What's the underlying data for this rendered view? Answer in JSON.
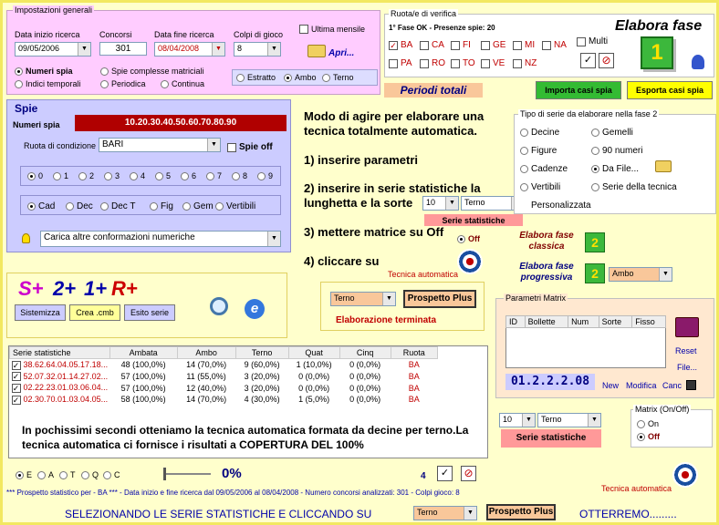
{
  "impostazioni": {
    "legend": "Impostazioni generali",
    "data_inizio_label": "Data inizio ricerca",
    "data_inizio": "09/05/2006",
    "concorsi_label": "Concorsi",
    "concorsi": "301",
    "data_fine_label": "Data fine ricerca",
    "data_fine": "08/04/2008",
    "colpi_label": "Colpi di gioco",
    "colpi": "8",
    "ultima_mensile": "Ultima mensile",
    "apri": "Apri...",
    "modes": [
      "Numeri spia",
      "Spie complesse matriciali",
      "Indici temporali",
      "Periodica",
      "Continua"
    ],
    "sorte": [
      "Estratto",
      "Ambo",
      "Terno"
    ]
  },
  "ruote": {
    "legend": "Ruota/e di verifica",
    "status": "1° Fase OK - Presenze spie: 20",
    "row1": [
      "BA",
      "CA",
      "FI",
      "GE",
      "MI",
      "NA"
    ],
    "row2": [
      "PA",
      "RO",
      "TO",
      "VE",
      "NZ"
    ],
    "multi": "Multi"
  },
  "elabora_fase": "Elabora fase",
  "fase_num": "1",
  "periodi_totali": "Periodi totali",
  "importa": "Importa casi spia",
  "esporta": "Esporta casi spia",
  "spie": {
    "title": "Spie",
    "numeri_spia_label": "Numeri spia",
    "numeri_spia": "10.20.30.40.50.60.70.80.90",
    "ruota_label": "Ruota di condizione",
    "ruota": "BARI",
    "spie_off": "Spie off",
    "digits": [
      "0",
      "1",
      "2",
      "3",
      "4",
      "5",
      "6",
      "7",
      "8",
      "9"
    ],
    "types": [
      "Cad",
      "Dec",
      "Dec T",
      "Fig",
      "Gem",
      "Vertibili"
    ],
    "carica": "Carica altre conformazioni numeriche"
  },
  "istruzioni": {
    "intro": "Modo di agire per elaborare una tecnica totalmente automatica.",
    "step1": "1) inserire parametri",
    "step2": "2) inserire in serie statistiche la lunghetta e la sorte",
    "step3": "3) mettere matrice su Off",
    "step4": "4) cliccare su",
    "lunghetta": "10",
    "sorte": "Terno",
    "serie_btn": "Serie statistiche",
    "off": "Off",
    "tecnica_automatica": "Tecnica automatica"
  },
  "tipo_serie": {
    "legend": "Tipo di serie da elaborare nella fase 2",
    "options": [
      "Decine",
      "Gemelli",
      "Figure",
      "90 numeri",
      "Cadenze",
      "Da File...",
      "Vertibili",
      "Serie della tecnica"
    ],
    "personalizzata": "Personalizzata",
    "classica": "Elabora fase classica",
    "progressiva": "Elabora fase progressiva",
    "fase2": "2",
    "ambo": "Ambo"
  },
  "splus": {
    "s": "S+",
    "two": "2+",
    "one": "1+",
    "r": "R+",
    "sistemizza": "Sistemizza",
    "crea": "Crea .cmb",
    "esito": "Esito serie"
  },
  "prospetto": {
    "sorte": "Terno",
    "btn": "Prospetto Plus",
    "status": "Elaborazione terminata"
  },
  "matrix": {
    "legend": "Parametri Matrix",
    "cols": [
      "ID",
      "Bollette",
      "Num",
      "Sorte",
      "Fisso"
    ],
    "reset": "Reset",
    "file": "File...",
    "code": "01.2.2.2.08",
    "new": "New",
    "modifica": "Modifica",
    "canc": "Canc",
    "onoff_legend": "Matrix (On/Off)",
    "on": "On",
    "off": "Off",
    "lunghetta": "10",
    "sorte": "Terno",
    "serie_btn": "Serie statistiche",
    "tecnica_automatica": "Tecnica automatica"
  },
  "table": {
    "headers": [
      "Serie statistiche",
      "Ambata",
      "Ambo",
      "Terno",
      "Quat",
      "Cinq",
      "Ruota"
    ],
    "rows": [
      [
        "38.62.64.04.05.17.18...",
        "48 (100,0%)",
        "14 (70,0%)",
        "9 (60,0%)",
        "1 (10,0%)",
        "0 (0,0%)",
        "BA"
      ],
      [
        "52.07.32.01.14.27.02...",
        "57 (100,0%)",
        "11 (55,0%)",
        "3 (20,0%)",
        "0 (0,0%)",
        "0 (0,0%)",
        "BA"
      ],
      [
        "02.22.23.01.03.06.04...",
        "57 (100,0%)",
        "12 (40,0%)",
        "3 (20,0%)",
        "0 (0,0%)",
        "0 (0,0%)",
        "BA"
      ],
      [
        "02.30.70.01.03.04.05...",
        "58 (100,0%)",
        "14 (70,0%)",
        "4 (30,0%)",
        "1 (5,0%)",
        "0 (0,0%)",
        "BA"
      ]
    ],
    "note": "In pochissimi secondi otteniamo la tecnica automatica formata da decine per terno.La tecnica automatica ci fornisce i risultati a COPERTURA DEL 100%"
  },
  "bottom": {
    "filters": [
      "E",
      "A",
      "T",
      "Q",
      "C"
    ],
    "percent": "0%",
    "count": "4",
    "status": "*** Prospetto statistico per  - BA *** - Data inizio e fine ricerca dal 09/05/2006 al 08/04/2008 - Numero concorsi analizzati: 301 - Colpi gioco: 8",
    "footer_left": "SELEZIONANDO LE SERIE STATISTICHE E CLICCANDO SU",
    "footer_sorte": "Terno",
    "footer_btn": "Prospetto Plus",
    "footer_right": "OTTERREMO........."
  },
  "colors": {
    "pink": "#ffccff",
    "lavender": "#ccccff",
    "red": "#cc0000",
    "green": "#33bb33",
    "yellow": "#ffff00",
    "blue": "#0000aa"
  }
}
